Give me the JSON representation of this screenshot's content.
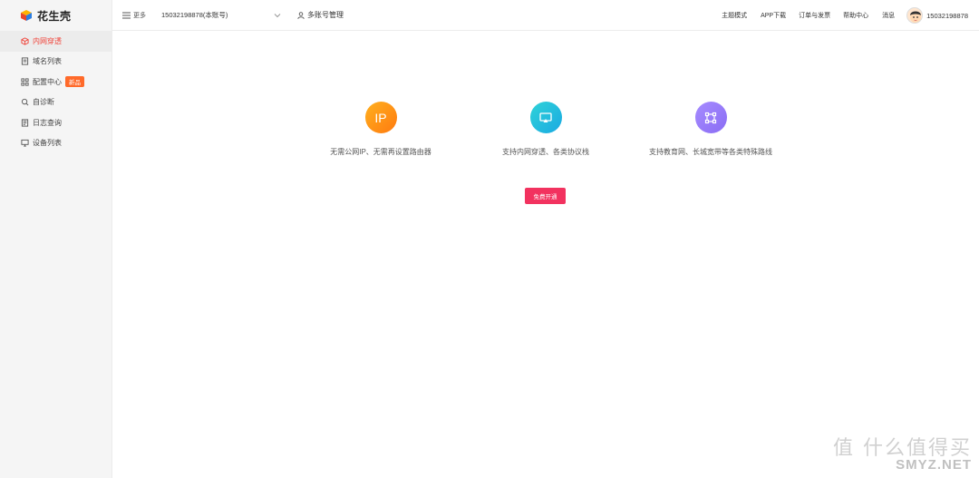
{
  "app": {
    "name": "花生壳"
  },
  "sidebar": {
    "items": [
      {
        "label": "内网穿透",
        "icon": "cube-icon",
        "active": true
      },
      {
        "label": "域名列表",
        "icon": "list-icon"
      },
      {
        "label": "配置中心",
        "icon": "grid-icon",
        "badge": "新品"
      },
      {
        "label": "自诊断",
        "icon": "diagnose-icon"
      },
      {
        "label": "日志查询",
        "icon": "log-icon"
      },
      {
        "label": "设备列表",
        "icon": "monitor-icon"
      }
    ]
  },
  "header": {
    "menu_label": "更多",
    "account": "15032198878(本账号)",
    "multi_account": "多账号管理",
    "links": [
      "主题模式",
      "APP下载",
      "订单与发票",
      "帮助中心",
      "消息"
    ],
    "user_phone": "15032198878"
  },
  "main": {
    "features": [
      {
        "icon_text": "IP",
        "caption": "无需公网IP、无需再设置路由器",
        "color": "#ff8c15"
      },
      {
        "caption": "支持内网穿透、各类协议栈",
        "color": "#22bde0"
      },
      {
        "caption": "支持教育网、长城宽带等各类特殊路线",
        "color": "#9a7cf8"
      }
    ],
    "cta_label": "免费开通"
  },
  "watermark": {
    "cn": "值 什么值得买",
    "en": "SMYZ.NET"
  },
  "colors": {
    "accent": "#f0443a",
    "cta": "#f2325f",
    "badge": "#ff6a2a"
  }
}
